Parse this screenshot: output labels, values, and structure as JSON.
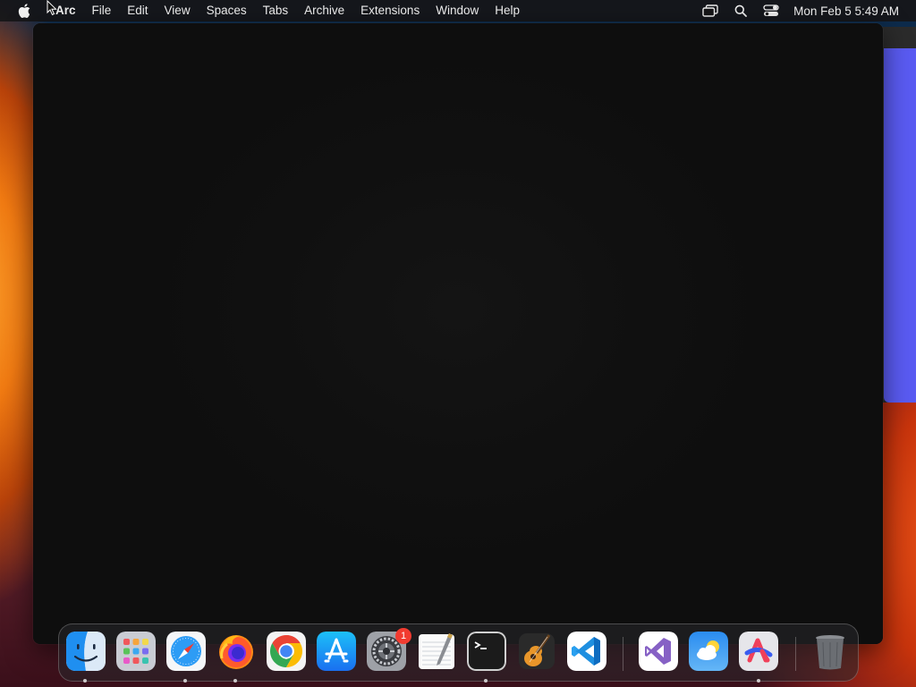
{
  "menubar": {
    "app_name": "Arc",
    "items": [
      "File",
      "Edit",
      "View",
      "Spaces",
      "Tabs",
      "Archive",
      "Extensions",
      "Window",
      "Help"
    ],
    "status_icons": [
      "screen-mirroring-icon",
      "search-icon",
      "control-center-icon"
    ],
    "clock": "Mon Feb 5  5:49 AM"
  },
  "window": {
    "app": "Arc",
    "state": "blank"
  },
  "dock": {
    "apps": [
      {
        "name": "Finder",
        "icon": "finder-icon",
        "running": true
      },
      {
        "name": "Launchpad",
        "icon": "launchpad-icon",
        "running": false
      },
      {
        "name": "Safari",
        "icon": "safari-icon",
        "running": true
      },
      {
        "name": "Firefox",
        "icon": "firefox-icon",
        "running": true
      },
      {
        "name": "Google Chrome",
        "icon": "chrome-icon",
        "running": false
      },
      {
        "name": "App Store",
        "icon": "app-store-icon",
        "running": false
      },
      {
        "name": "System Settings",
        "icon": "system-settings-icon",
        "running": false,
        "badge": "1"
      },
      {
        "name": "TextEdit",
        "icon": "textedit-icon",
        "running": false
      },
      {
        "name": "Terminal",
        "icon": "terminal-icon",
        "running": true
      },
      {
        "name": "GarageBand",
        "icon": "garageband-icon",
        "running": false
      },
      {
        "name": "Visual Studio Code",
        "icon": "vscode-icon",
        "running": false
      },
      {
        "name": "Visual Studio",
        "icon": "visual-studio-icon",
        "running": false
      },
      {
        "name": "Weather",
        "icon": "weather-icon",
        "running": false
      },
      {
        "name": "Arc",
        "icon": "arc-icon",
        "running": true
      },
      {
        "name": "Trash",
        "icon": "trash-icon",
        "running": false
      }
    ],
    "badge_system_settings": "1"
  },
  "colors": {
    "menubar_bg": "#161618",
    "window_bg": "#0f0f0f",
    "background_window_accent": "#5a5bf2",
    "badge": "#f23b30"
  }
}
